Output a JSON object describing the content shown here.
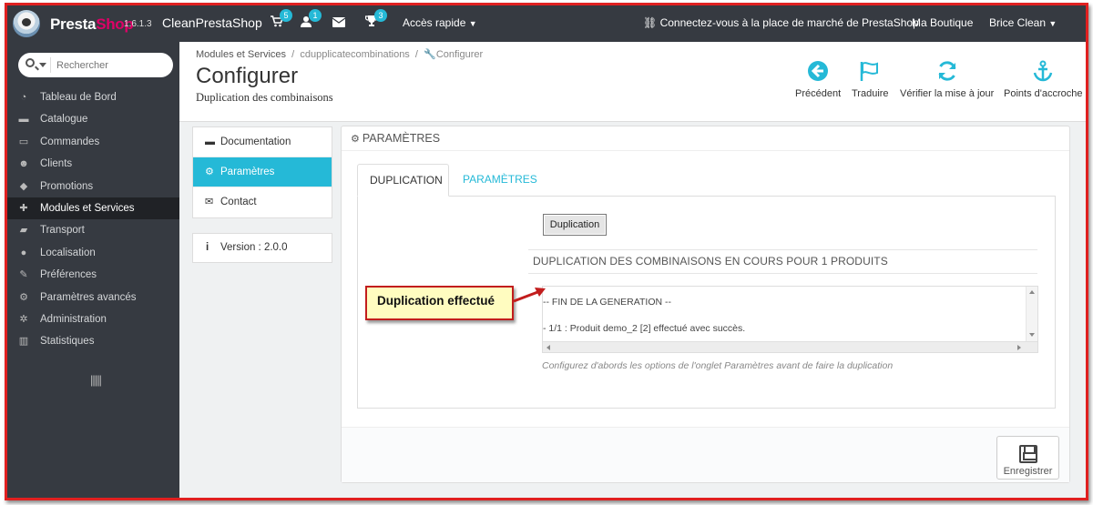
{
  "topbar": {
    "brand_first": "Presta",
    "brand_second": "Shop",
    "version": "1.6.1.3",
    "shop_name": "CleanPrestaShop",
    "cart_count": "5",
    "customers_count": "1",
    "trophy_count": "3",
    "quick_access": "Accès rapide",
    "marketplace": "Connectez-vous à la place de marché de PrestaShop",
    "my_shop": "Ma Boutique",
    "user": "Brice Clean"
  },
  "sidebar": {
    "search_placeholder": "Rechercher",
    "items": [
      {
        "label": "Tableau de Bord",
        "icon": "dashboard-icon"
      },
      {
        "label": "Catalogue",
        "icon": "book-icon"
      },
      {
        "label": "Commandes",
        "icon": "credit-card-icon"
      },
      {
        "label": "Clients",
        "icon": "users-icon"
      },
      {
        "label": "Promotions",
        "icon": "tag-icon"
      },
      {
        "label": "Modules et Services",
        "icon": "puzzle-icon"
      },
      {
        "label": "Transport",
        "icon": "truck-icon"
      },
      {
        "label": "Localisation",
        "icon": "globe-icon"
      },
      {
        "label": "Préférences",
        "icon": "wrench-icon"
      },
      {
        "label": "Paramètres avancés",
        "icon": "cogs-icon"
      },
      {
        "label": "Administration",
        "icon": "gear-icon"
      },
      {
        "label": "Statistiques",
        "icon": "bar-chart-icon"
      }
    ],
    "active_item": "Modules et Services"
  },
  "header": {
    "breadcrumb": [
      "Modules et Services",
      "cdupplicatecombinations",
      "Configurer"
    ],
    "title": "Configurer",
    "subtitle": "Duplication des combinaisons",
    "toolbar": [
      {
        "label": "Précédent",
        "icon": "arrow-circle-left-icon"
      },
      {
        "label": "Traduire",
        "icon": "flag-icon"
      },
      {
        "label": "Vérifier la mise à jour",
        "icon": "refresh-icon"
      },
      {
        "label": "Points d'accroche",
        "icon": "anchor-icon"
      }
    ]
  },
  "config_menu": {
    "items": [
      "Documentation",
      "Paramètres",
      "Contact"
    ],
    "active": "Paramètres",
    "version": "Version : 2.0.0"
  },
  "panel": {
    "heading": "PARAMÈTRES",
    "tabs": [
      "DUPLICATION",
      "PARAMÈTRES"
    ],
    "active_tab": "DUPLICATION",
    "duplicate_button": "Duplication",
    "status_heading": "DUPLICATION DES COMBINAISONS EN COURS POUR 1 PRODUITS",
    "log_lines": [
      "-- FIN DE LA GENERATION --",
      "- 1/1 : Produit demo_2 [2] effectué avec succès."
    ],
    "hint": "Configurez d'abords les options de l'onglet Paramètres avant de faire la duplication",
    "save_label": "Enregistrer"
  },
  "annotation": {
    "text": "Duplication effectué"
  },
  "colors": {
    "accent": "#25b9d7",
    "topbar_bg": "#363a41",
    "annotation_border": "#c21d1d",
    "annotation_bg": "#fffcc0"
  }
}
